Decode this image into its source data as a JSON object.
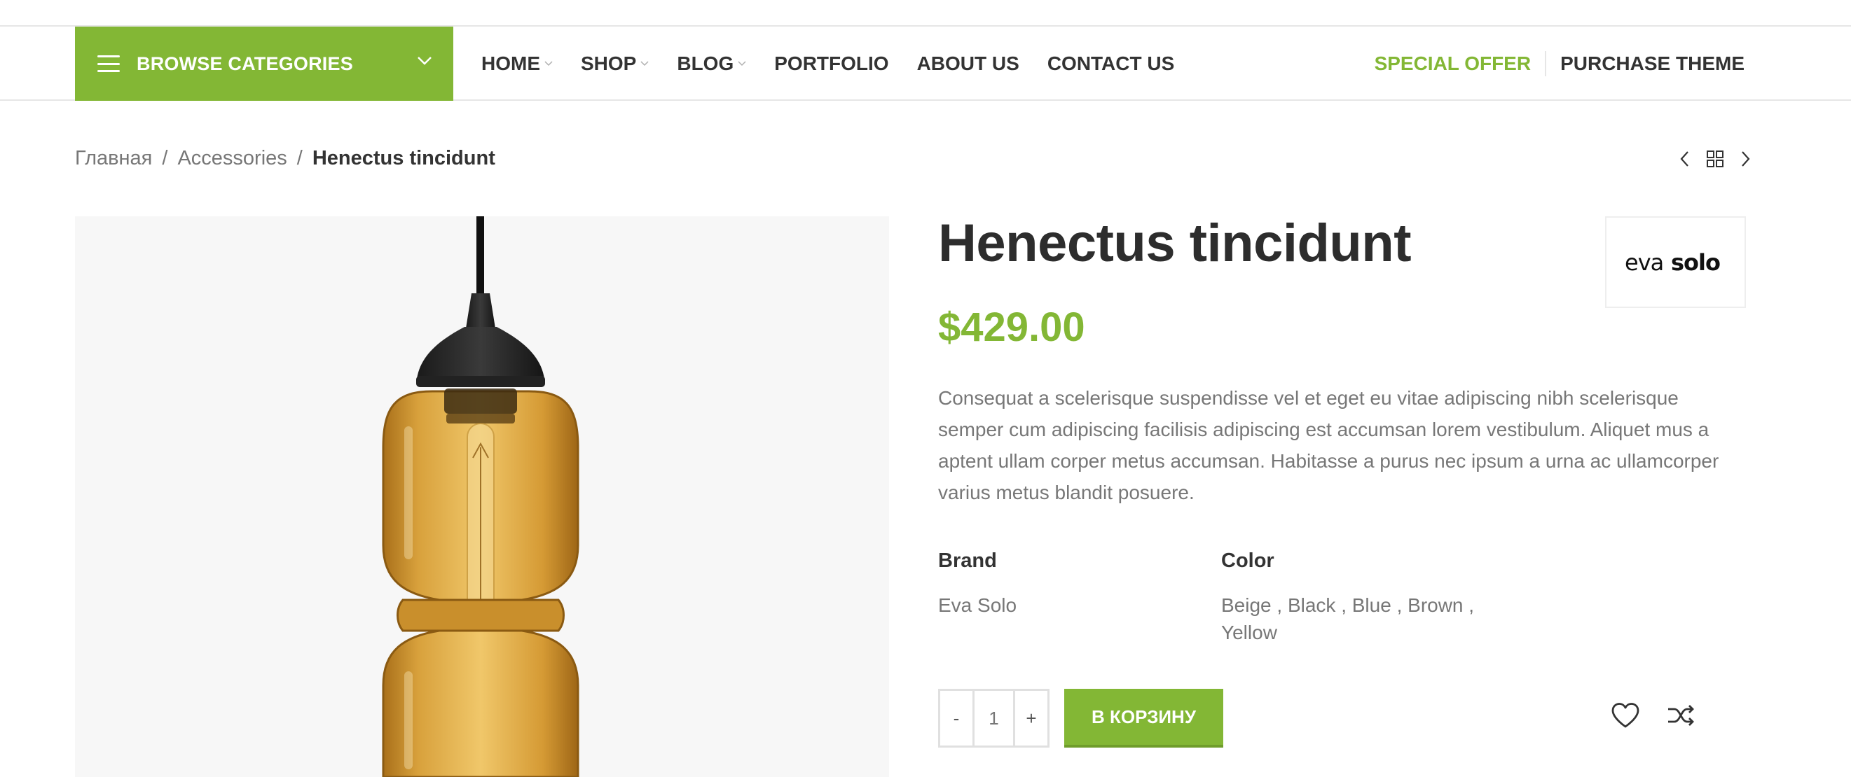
{
  "nav": {
    "browse_label": "BROWSE CATEGORIES",
    "menu": [
      {
        "label": "HOME",
        "has_dropdown": true
      },
      {
        "label": "SHOP",
        "has_dropdown": true
      },
      {
        "label": "BLOG",
        "has_dropdown": true
      },
      {
        "label": "PORTFOLIO",
        "has_dropdown": false
      },
      {
        "label": "ABOUT US",
        "has_dropdown": false
      },
      {
        "label": "CONTACT US",
        "has_dropdown": false
      }
    ],
    "special_offer": "SPECIAL OFFER",
    "purchase_theme": "PURCHASE THEME"
  },
  "breadcrumb": {
    "items": [
      "Главная",
      "Accessories"
    ],
    "separator": "/",
    "current": "Henectus tincidunt"
  },
  "product": {
    "title": "Henectus tincidunt",
    "price": "$429.00",
    "description": "Consequat a scelerisque suspendisse vel et eget eu vitae adipiscing nibh scelerisque semper cum adipiscing facilisis adipiscing est accumsan lorem vestibulum. Aliquet mus a aptent ullam corper metus accumsan. Habitasse a purus nec ipsum a urna ac ullamcorper varius metus blandit posuere.",
    "brand_logo_text": "eva solo",
    "attributes": {
      "brand_label": "Brand",
      "brand_value": "Eva Solo",
      "color_label": "Color",
      "color_value_line1": "Beige , Black , Blue , Brown ,",
      "color_value_line2": "Yellow"
    },
    "quantity": {
      "minus": "-",
      "value": "1",
      "plus": "+"
    },
    "add_to_cart": "В КОРЗИНУ"
  },
  "icons": {
    "menu": "hamburger-icon",
    "browse_chevron": "chevron-down-icon",
    "prev": "chevron-left-icon",
    "grid": "grid-icon",
    "next": "chevron-right-icon",
    "wishlist": "heart-icon",
    "compare": "shuffle-icon"
  },
  "colors": {
    "accent": "#83b735",
    "text_dark": "#333333",
    "text_muted": "#777777",
    "image_bg": "#f7f7f7",
    "lamp_amber": "#e2a93a"
  }
}
